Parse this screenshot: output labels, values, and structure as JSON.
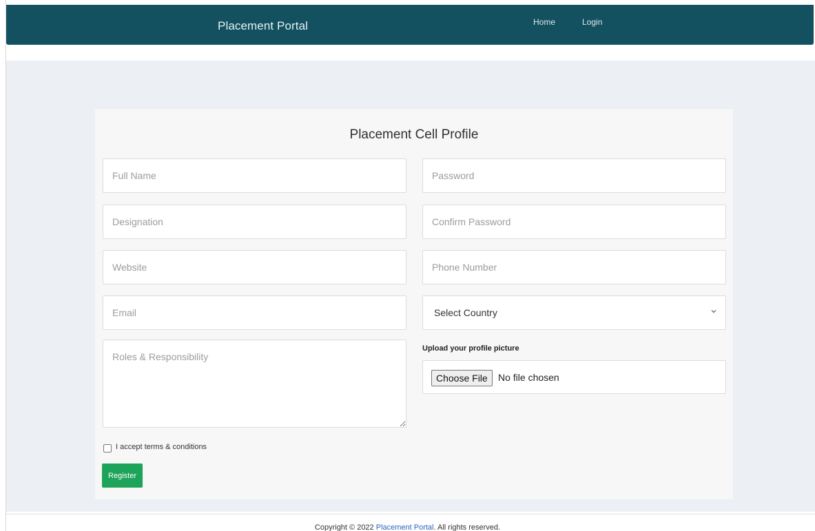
{
  "navbar": {
    "brand": "Placement Portal",
    "links": [
      "Home",
      "Login"
    ],
    "color": "#135160"
  },
  "form": {
    "title": "Placement Cell Profile",
    "placeholders": {
      "full_name": "Full Name",
      "designation": "Designation",
      "website": "Website",
      "email": "Email",
      "roles": "Roles & Responsibility",
      "password": "Password",
      "confirm_password": "Confirm Password",
      "phone": "Phone Number"
    },
    "country_select": {
      "selected": "Select Country",
      "icon": "chevron-down-icon"
    },
    "upload": {
      "label": "Upload your profile picture",
      "button": "Choose File",
      "status": "No file chosen"
    },
    "terms_label": "I accept terms & conditions",
    "terms_checked": false,
    "register_label": "Register",
    "register_color": "#1ea35a"
  },
  "footer": {
    "prefix": "Copyright © 2022 ",
    "link": "Placement Portal",
    "suffix": ". All rights reserved."
  }
}
